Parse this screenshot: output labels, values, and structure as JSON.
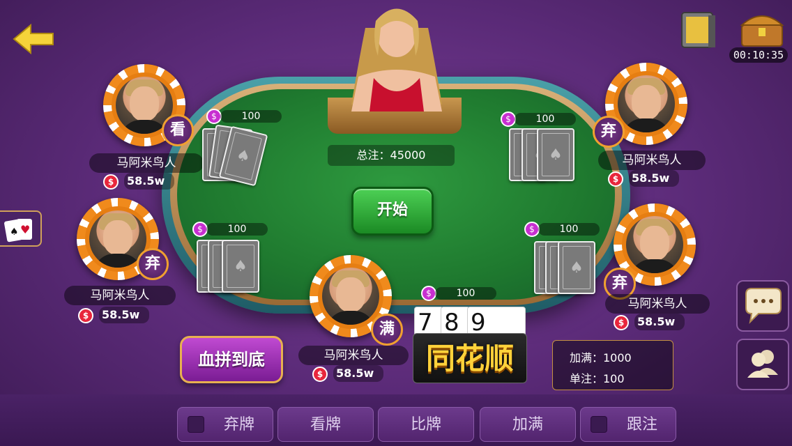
{
  "timer": "00:10:35",
  "pot": {
    "label": "总注：45000"
  },
  "start_button": "开始",
  "blood_button": "血拼到底",
  "hand": {
    "cards": [
      "7",
      "8",
      "9"
    ],
    "type": "同花顺"
  },
  "info": {
    "max_raise": "加满：1000",
    "single_bet": "单注：100"
  },
  "players": [
    {
      "name": "马阿米鸟人",
      "money": "58.5w",
      "status": "看",
      "bet": "100"
    },
    {
      "name": "马阿米鸟人",
      "money": "58.5w",
      "status": "弃",
      "bet": "100"
    },
    {
      "name": "马阿米鸟人",
      "money": "58.5w",
      "status": "满",
      "bet": "100"
    },
    {
      "name": "马阿米鸟人",
      "money": "58.5w",
      "status": "弃",
      "bet": "100"
    },
    {
      "name": "马阿米鸟人",
      "money": "58.5w",
      "status": "弃",
      "bet": "100"
    }
  ],
  "actions": {
    "fold": "弃牌",
    "look": "看牌",
    "compare": "比牌",
    "max": "加满",
    "follow": "跟注"
  },
  "icons": {
    "coin": "$",
    "card_back": "♠"
  }
}
